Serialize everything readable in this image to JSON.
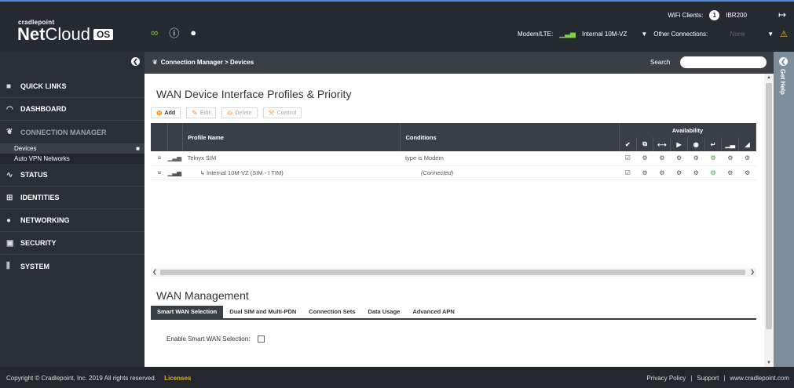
{
  "header": {
    "logo_small": "cradlepoint",
    "logo_net": "Net",
    "logo_cloud": "Cloud",
    "logo_os": "OS",
    "wifi_clients_label": "WiFi Clients:",
    "wifi_clients_count": "1",
    "device_name": "IBR200",
    "modem_label": "Modem/LTE:",
    "modem_value": "Internal 10M-VZ",
    "other_connections_label": "Other Connections:",
    "other_connections_value": "None"
  },
  "sidebar": {
    "items": [
      {
        "label": "QUICK LINKS"
      },
      {
        "label": "DASHBOARD"
      },
      {
        "label": "CONNECTION MANAGER"
      },
      {
        "label": "STATUS"
      },
      {
        "label": "IDENTITIES"
      },
      {
        "label": "NETWORKING"
      },
      {
        "label": "SECURITY"
      },
      {
        "label": "SYSTEM"
      }
    ],
    "sub_items": [
      {
        "label": "Devices"
      },
      {
        "label": "Auto VPN Networks"
      }
    ]
  },
  "breadcrumb": "Connection Manager > Devices",
  "search": {
    "label": "Search",
    "placeholder": ""
  },
  "help_label": "Get Help",
  "wan_devices": {
    "title": "WAN Device Interface Profiles & Priority",
    "toolbar": {
      "add": "Add",
      "edit": "Edit",
      "delete": "Delete",
      "control": "Control"
    },
    "columns": {
      "profile_name": "Profile Name",
      "conditions": "Conditions",
      "availability": "Availability"
    },
    "rows": [
      {
        "profile": "Telnyx SIM",
        "conditions": "type is Modem"
      },
      {
        "profile": "Internal 10M-VZ (SIM - I TIM)",
        "conditions": "(Connected)"
      }
    ]
  },
  "wan_management": {
    "title": "WAN Management",
    "tabs": [
      "Smart WAN Selection",
      "Dual SIM and Multi-PDN",
      "Connection Sets",
      "Data Usage",
      "Advanced APN"
    ],
    "enable_label": "Enable Smart WAN Selection:"
  },
  "footer": {
    "copyright": "Copyright © Cradlepoint, Inc. 2019 All rights reserved.",
    "licenses": "Licenses",
    "privacy": "Privacy Policy",
    "sep": "|",
    "support": "Support",
    "website": "www.cradlepoint.com"
  }
}
